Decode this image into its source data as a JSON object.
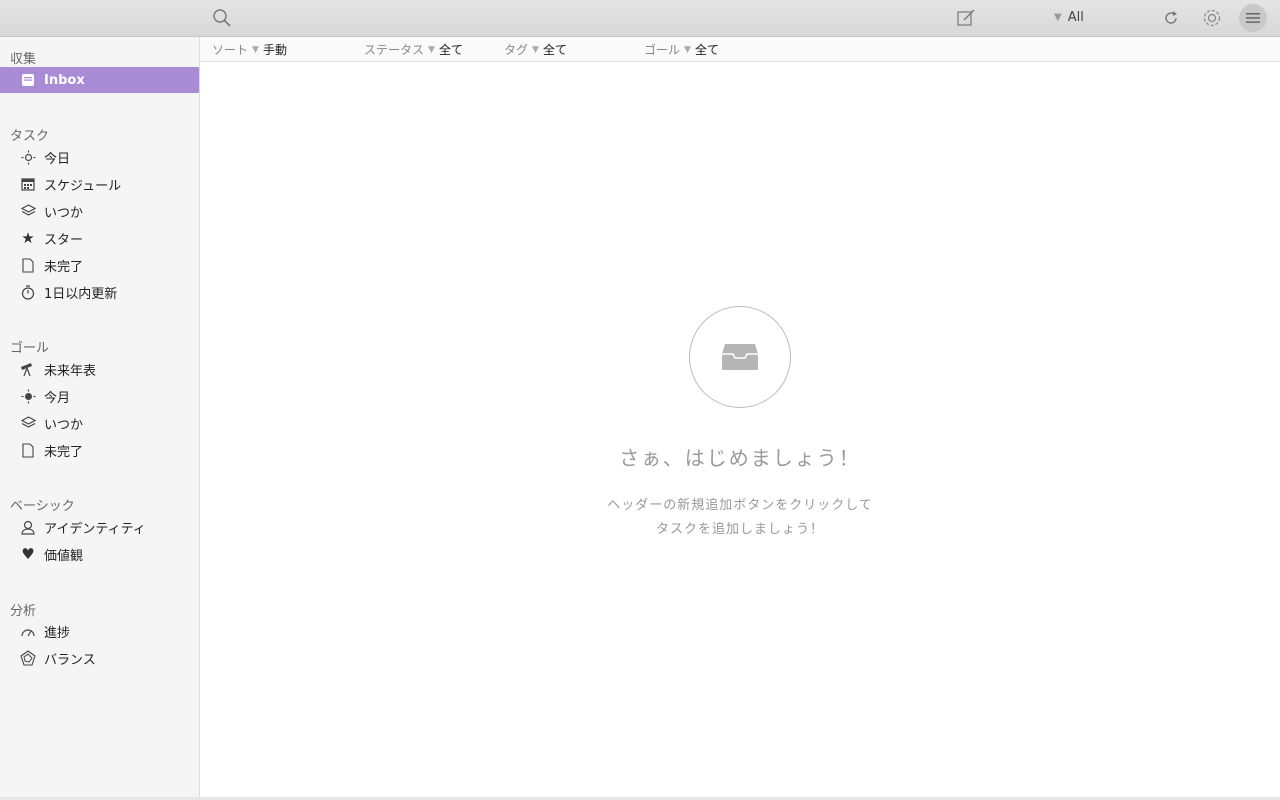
{
  "toolbar": {
    "filter_label": "All"
  },
  "sidebar": {
    "sections": {
      "collect": "収集",
      "tasks": "タスク",
      "goals": "ゴール",
      "basics": "ベーシック",
      "analysis": "分析"
    },
    "collect_items": [
      "Inbox"
    ],
    "task_items": [
      "今日",
      "スケジュール",
      "いつか",
      "スター",
      "未完了",
      "1日以内更新"
    ],
    "goal_items": [
      "未来年表",
      "今月",
      "いつか",
      "未完了"
    ],
    "basic_items": [
      "アイデンティティ",
      "価値観"
    ],
    "analysis_items": [
      "進捗",
      "バランス"
    ]
  },
  "filters": {
    "sort": {
      "label": "ソート",
      "value": "手動"
    },
    "status": {
      "label": "ステータス",
      "value": "全て"
    },
    "tag": {
      "label": "タグ",
      "value": "全て"
    },
    "goal": {
      "label": "ゴール",
      "value": "全て"
    }
  },
  "empty_state": {
    "title": "さぁ、はじめましょう！",
    "line1": "ヘッダーの新規追加ボタンをクリックして",
    "line2": "タスクを追加しましょう！"
  },
  "colors": {
    "accent": "#a98cd6",
    "sidebar_bg": "#f5f5f5",
    "toolbar_bg": "#dcdcdc"
  }
}
